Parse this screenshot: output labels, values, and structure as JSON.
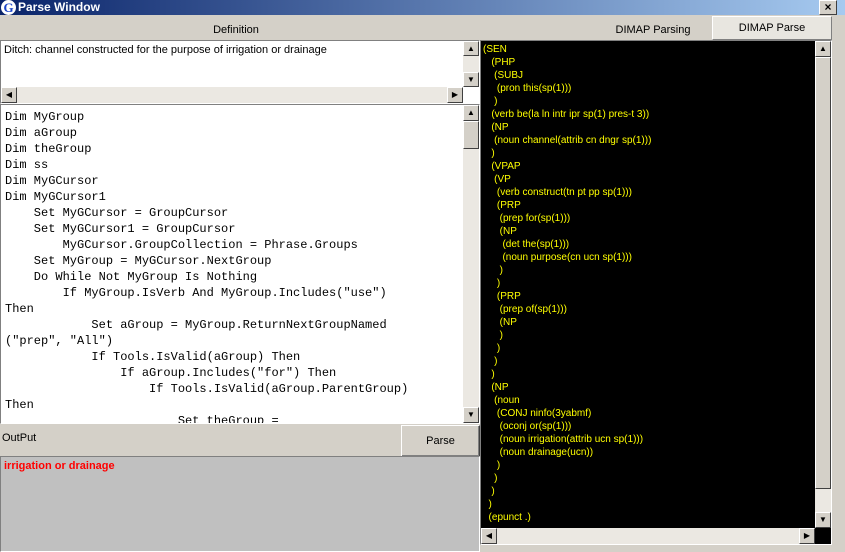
{
  "window": {
    "title": "Parse Window",
    "icon_letter": "G",
    "close": "×"
  },
  "headers": {
    "definition": "Definition",
    "dimap_parsing": "DIMAP Parsing",
    "dimap_parse_tab": "DIMAP Parse"
  },
  "definition": {
    "text": "Ditch: channel constructed for the purpose of irrigation or drainage"
  },
  "code": {
    "lines": [
      "Dim MyGroup",
      "Dim aGroup",
      "Dim theGroup",
      "Dim ss",
      "Dim MyGCursor",
      "Dim MyGCursor1",
      "    Set MyGCursor = GroupCursor",
      "    Set MyGCursor1 = GroupCursor",
      "        MyGCursor.GroupCollection = Phrase.Groups",
      "    Set MyGroup = MyGCursor.NextGroup",
      "    Do While Not MyGroup Is Nothing",
      "        If MyGroup.IsVerb And MyGroup.Includes(\"use\")",
      "Then",
      "            Set aGroup = MyGroup.ReturnNextGroupNamed",
      "(\"prep\", \"All\")",
      "            If Tools.IsValid(aGroup) Then",
      "                If aGroup.Includes(\"for\") Then",
      "                    If Tools.IsValid(aGroup.ParentGroup)",
      "Then",
      "                        Set theGroup ="
    ]
  },
  "output": {
    "label": "OutPut",
    "parse_button": "Parse",
    "text": "irrigation or drainage"
  },
  "parse_tree": {
    "lines": [
      "(SEN",
      "   (PHP",
      "    (SUBJ",
      "     (pron this(sp(1)))",
      "    )",
      "   (verb be(la ln intr ipr sp(1) pres-t 3))",
      "   (NP",
      "    (noun channel(attrib cn dngr sp(1)))",
      "   )",
      "   (VPAP",
      "    (VP",
      "     (verb construct(tn pt pp sp(1)))",
      "     (PRP",
      "      (prep for(sp(1)))",
      "      (NP",
      "       (det the(sp(1)))",
      "       (noun purpose(cn ucn sp(1)))",
      "      )",
      "     )",
      "     (PRP",
      "      (prep of(sp(1)))",
      "      (NP",
      "      )",
      "     )",
      "    )",
      "   )",
      "   (NP",
      "    (noun",
      "     (CONJ ninfo(3yabmf)",
      "      (oconj or(sp(1)))",
      "      (noun irrigation(attrib ucn sp(1)))",
      "      (noun drainage(ucn))",
      "     )",
      "    )",
      "   )",
      "  )",
      "  (epunct .)"
    ]
  },
  "colors": {
    "parse_text": "#ffff00",
    "parse_bg": "#000000",
    "output_text": "#ff0000"
  }
}
